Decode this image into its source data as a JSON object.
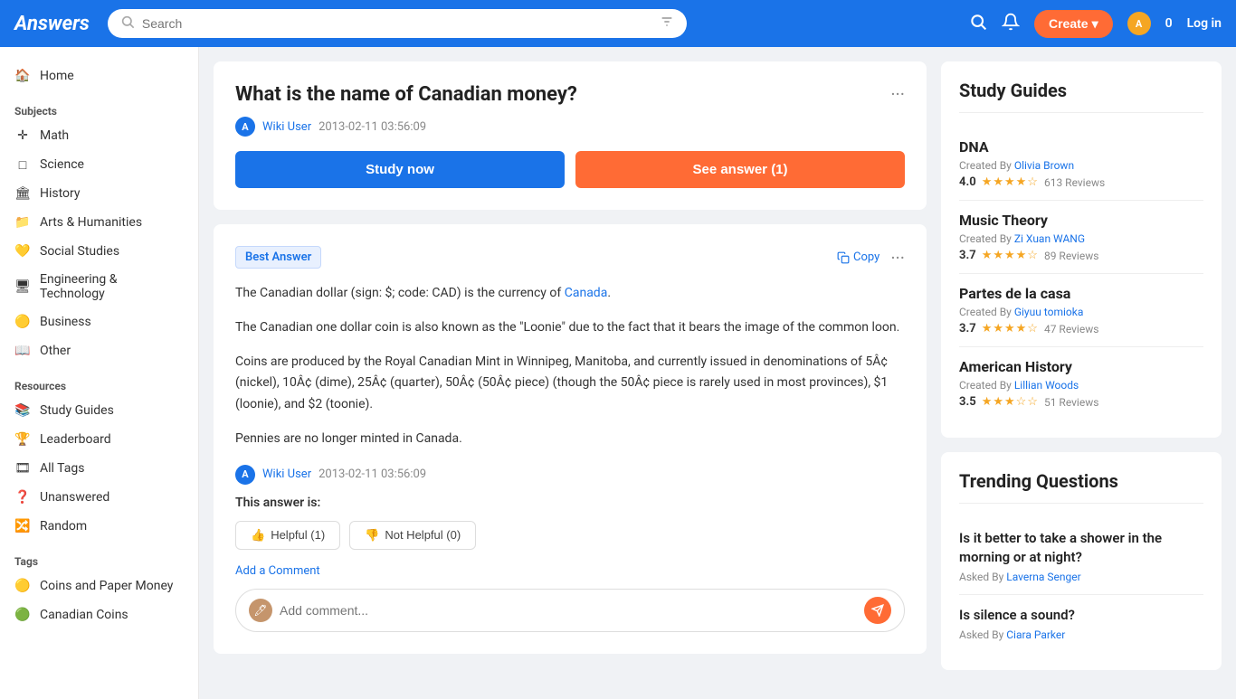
{
  "header": {
    "logo": "Answers",
    "search_placeholder": "Search",
    "create_label": "Create",
    "coins": "0",
    "login_label": "Log in"
  },
  "sidebar": {
    "home_label": "Home",
    "subjects_label": "Subjects",
    "subjects": [
      {
        "id": "math",
        "label": "Math",
        "icon": "✛"
      },
      {
        "id": "science",
        "label": "Science",
        "icon": "□"
      },
      {
        "id": "history",
        "label": "History",
        "icon": "🏛"
      },
      {
        "id": "arts",
        "label": "Arts & Humanities",
        "icon": "📁"
      },
      {
        "id": "social",
        "label": "Social Studies",
        "icon": "💛"
      },
      {
        "id": "engineering",
        "label": "Engineering & Technology",
        "icon": "🖥"
      },
      {
        "id": "business",
        "label": "Business",
        "icon": "🟡"
      },
      {
        "id": "other",
        "label": "Other",
        "icon": "📖"
      }
    ],
    "resources_label": "Resources",
    "resources": [
      {
        "id": "study-guides",
        "label": "Study Guides",
        "icon": "📚"
      },
      {
        "id": "leaderboard",
        "label": "Leaderboard",
        "icon": "🏆"
      },
      {
        "id": "all-tags",
        "label": "All Tags",
        "icon": "🎞"
      },
      {
        "id": "unanswered",
        "label": "Unanswered",
        "icon": "❓"
      },
      {
        "id": "random",
        "label": "Random",
        "icon": "🔀"
      }
    ],
    "tags_label": "Tags",
    "tags": [
      {
        "id": "coins-paper",
        "label": "Coins and Paper Money",
        "icon": "🟡"
      },
      {
        "id": "canadian-coins",
        "label": "Canadian Coins",
        "icon": "🟢"
      }
    ]
  },
  "question": {
    "title": "What is the name of Canadian money?",
    "author": "Wiki User",
    "date": "2013-02-11 03:56:09",
    "study_now_label": "Study now",
    "see_answer_label": "See answer (1)"
  },
  "answer": {
    "best_answer_label": "Best Answer",
    "copy_label": "Copy",
    "body_paragraphs": [
      "The Canadian dollar (sign: $; code: CAD) is the currency of Canada.",
      "The Canadian one dollar coin is also known as the \"Loonie\" due to the fact that it bears the image of the common loon.",
      "Coins are produced by the Royal Canadian Mint in Winnipeg, Manitoba, and currently issued in denominations of 5Â¢ (nickel), 10Â¢ (dime), 25Â¢ (quarter), 50Â¢ (50Â¢ piece) (though the 50Â¢ piece is rarely used in most provinces), $1 (loonie), and $2 (toonie).",
      "Pennies are no longer minted in Canada."
    ],
    "canada_link": "Canada",
    "author": "Wiki User",
    "date": "2013-02-11 03:56:09",
    "this_answer_is": "This answer is:",
    "helpful_label": "Helpful (1)",
    "not_helpful_label": "Not Helpful (0)",
    "add_comment_label": "Add a Comment",
    "comment_placeholder": "Add comment..."
  },
  "study_guides": {
    "title": "Study Guides",
    "items": [
      {
        "name": "DNA",
        "created_by": "Created By",
        "author": "Olivia Brown",
        "score": "4.0",
        "stars": 4,
        "reviews": "613 Reviews"
      },
      {
        "name": "Music Theory",
        "created_by": "Created By",
        "author": "Zi Xuan WANG",
        "score": "3.7",
        "stars": 3.5,
        "reviews": "89 Reviews"
      },
      {
        "name": "Partes de la casa",
        "created_by": "Created By",
        "author": "Giyuu tomioka",
        "score": "3.7",
        "stars": 3.5,
        "reviews": "47 Reviews"
      },
      {
        "name": "American History",
        "created_by": "Created By",
        "author": "Lillian Woods",
        "score": "3.5",
        "stars": 3,
        "reviews": "51 Reviews"
      }
    ]
  },
  "trending": {
    "title": "Trending Questions",
    "items": [
      {
        "question": "Is it better to take a shower in the morning or at night?",
        "asked_by": "Asked By",
        "author": "Laverna Senger"
      },
      {
        "question": "Is silence a sound?",
        "asked_by": "Asked By",
        "author": "Ciara Parker"
      }
    ]
  }
}
